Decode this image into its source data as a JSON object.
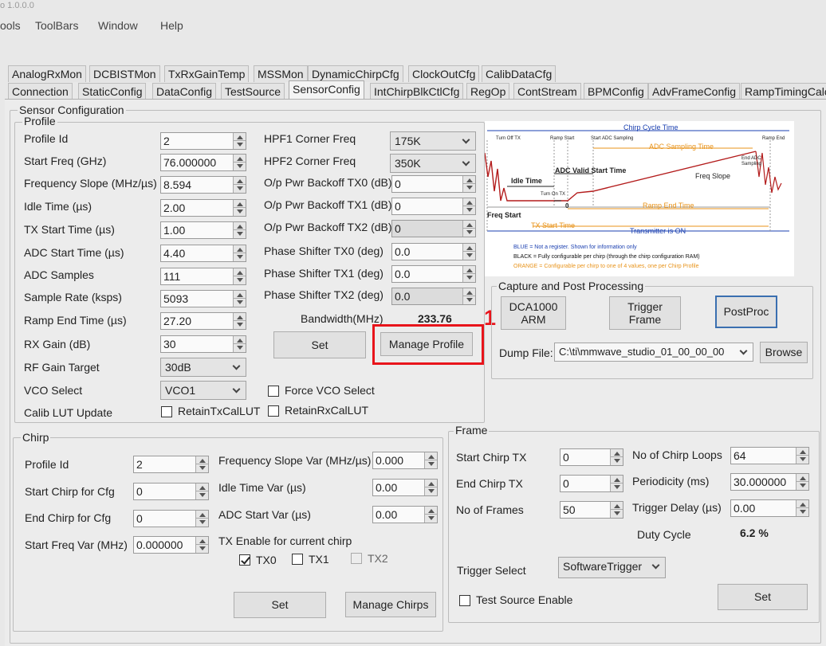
{
  "window": {
    "version": "o 1.0.0.0"
  },
  "menu": [
    "ools",
    "ToolBars",
    "Window",
    "Help"
  ],
  "tabs_row1": [
    "AnalogRxMon",
    "DCBISTMon",
    "TxRxGainTemp",
    "MSSMon",
    "DynamicChirpCfg",
    "ClockOutCfg",
    "CalibDataCfg"
  ],
  "tabs_row2": [
    "Connection",
    "StaticConfig",
    "DataConfig",
    "TestSource",
    "SensorConfig",
    "IntChirpBlkCtlCfg",
    "RegOp",
    "ContStream",
    "BPMConfig",
    "AdvFrameConfig",
    "RampTimingCalc"
  ],
  "sensor": {
    "title": "Sensor Configuration",
    "profile_title": "Profile"
  },
  "profile": {
    "fields": [
      {
        "label": "Profile Id",
        "value": "2"
      },
      {
        "label": "Start Freq (GHz)",
        "value": "76.000000"
      },
      {
        "label": "Frequency Slope (MHz/µs)",
        "value": "8.594"
      },
      {
        "label": "Idle Time (µs)",
        "value": "2.00"
      },
      {
        "label": "TX Start Time (µs)",
        "value": "1.00"
      },
      {
        "label": "ADC Start Time (µs)",
        "value": "4.40"
      },
      {
        "label": "ADC Samples",
        "value": "111"
      },
      {
        "label": "Sample Rate (ksps)",
        "value": "5093"
      },
      {
        "label": "Ramp End Time (µs)",
        "value": "27.20"
      },
      {
        "label": "RX Gain (dB)",
        "value": "30"
      }
    ],
    "rf_gain_label": "RF Gain Target",
    "rf_gain_value": "30dB",
    "vco_label": "VCO Select",
    "vco_value": "VCO1",
    "calib_label": "Calib LUT Update",
    "force_vco": "Force VCO Select",
    "retain_tx": "RetainTxCalLUT",
    "retain_rx": "RetainRxCalLUT",
    "hpf1_label": "HPF1 Corner Freq",
    "hpf1_value": "175K",
    "hpf2_label": "HPF2 Corner Freq",
    "hpf2_value": "350K",
    "right_fields": [
      {
        "label": "O/p Pwr Backoff TX0 (dB)",
        "value": "0"
      },
      {
        "label": "O/p Pwr Backoff TX1 (dB)",
        "value": "0"
      },
      {
        "label": "O/p Pwr Backoff TX2 (dB)",
        "value": "0"
      },
      {
        "label": "Phase Shifter TX0 (deg)",
        "value": "0.0"
      },
      {
        "label": "Phase Shifter TX1 (deg)",
        "value": "0.0"
      },
      {
        "label": "Phase Shifter TX2 (deg)",
        "value": "0.0"
      }
    ],
    "bandwidth_label": "Bandwidth(MHz)",
    "bandwidth_value": "233.76",
    "set_label": "Set",
    "manage_label": "Manage Profile"
  },
  "annotation": {
    "number": "1",
    "color": "#e8141b"
  },
  "diagram": {
    "chirp_cycle": "Chirp Cycle Time",
    "turn_off_tx": "Turn Off TX",
    "ramp_start": "Ramp Start",
    "start_adc": "Start ADC Sampling",
    "ramp_end": "Ramp End",
    "adc_sampling_time": "ADC Sampling Time",
    "end_adc": "End ADC Sampling",
    "adc_valid": "ADC Valid Start Time",
    "freq_slope": "Freq Slope",
    "idle_time": "Idle Time",
    "turn_on_tx": "Turn On TX",
    "zero": "0",
    "ramp_end_time": "Ramp End Time",
    "freq_start": "Freq Start",
    "tx_start": "TX Start Time",
    "tx_on": "Transmitter is ON",
    "legend_blue": "BLUE = Not a register. Shown for information only",
    "legend_black": "BLACK = Fully configurable per chirp (through the chirp configuration RAM)",
    "legend_orange": "ORANGE = Configurable per chirp to one of 4 values, one per Chirp Profile"
  },
  "capture": {
    "title": "Capture and Post Processing",
    "dca": "DCA1000 ARM",
    "trigger": "Trigger Frame",
    "postproc": "PostProc",
    "dump_label": "Dump File:",
    "dump_value": "C:\\ti\\mmwave_studio_01_00_00_00",
    "browse": "Browse"
  },
  "chirp": {
    "title": "Chirp",
    "left_fields": [
      {
        "label": "Profile Id",
        "value": "2"
      },
      {
        "label": "Start Chirp for Cfg",
        "value": "0"
      },
      {
        "label": "End Chirp for Cfg",
        "value": "0"
      },
      {
        "label": "Start Freq Var (MHz)",
        "value": "0.000000"
      }
    ],
    "right_fields": [
      {
        "label": "Frequency Slope Var (MHz/µs)",
        "value": "0.000"
      },
      {
        "label": "Idle Time Var (µs)",
        "value": "0.00"
      },
      {
        "label": "ADC Start Var (µs)",
        "value": "0.00"
      }
    ],
    "tx_enable_label": "TX Enable for current chirp",
    "tx0": "TX0",
    "tx1": "TX1",
    "tx2": "TX2",
    "set_label": "Set",
    "manage_label": "Manage Chirps"
  },
  "frame": {
    "title": "Frame",
    "start_chirp_label": "Start Chirp TX",
    "start_chirp_value": "0",
    "end_chirp_label": "End Chirp TX",
    "end_chirp_value": "0",
    "frames_label": "No of Frames",
    "frames_value": "50",
    "loops_label": "No of Chirp Loops",
    "loops_value": "64",
    "period_label": "Periodicity (ms)",
    "period_value": "30.000000",
    "delay_label": "Trigger Delay (µs)",
    "delay_value": "0.00",
    "duty_label": "Duty Cycle",
    "duty_value": "6.2 %",
    "trigger_label": "Trigger Select",
    "trigger_value": "SoftwareTrigger",
    "test_source": "Test Source Enable",
    "set_label": "Set"
  }
}
